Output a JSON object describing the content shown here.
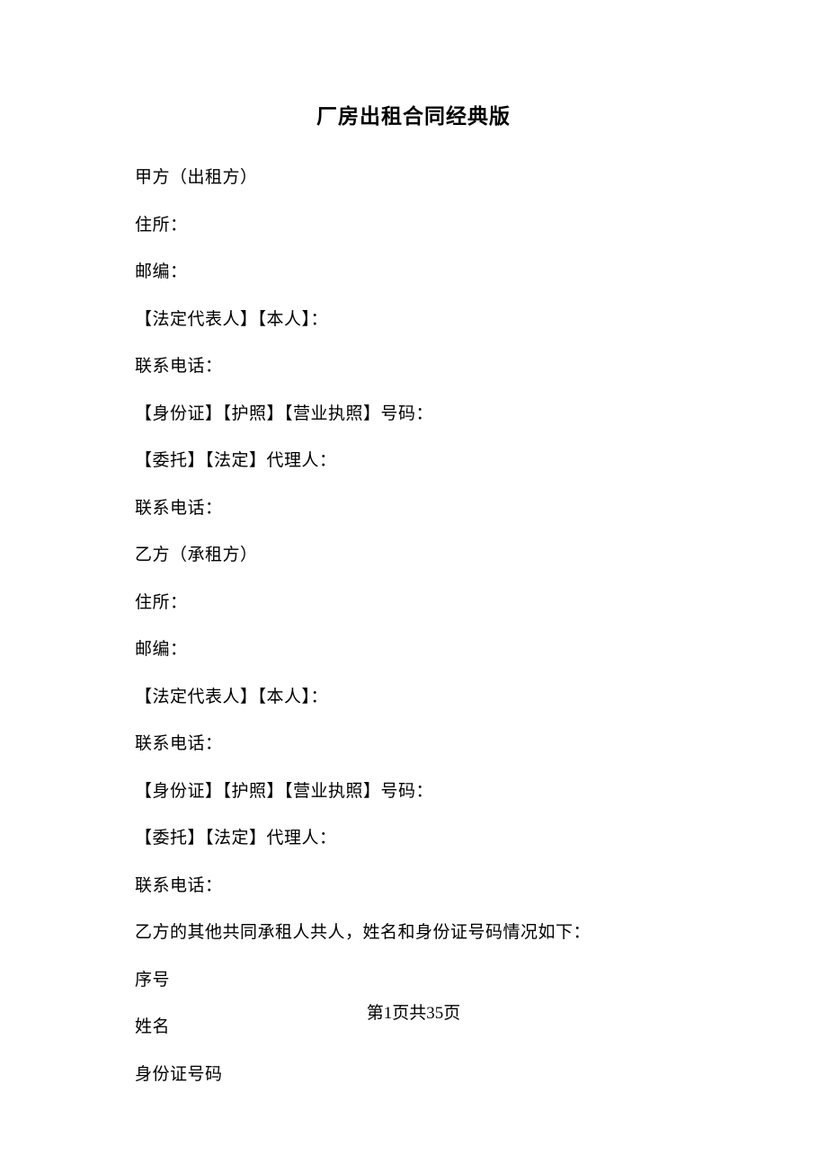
{
  "title": "厂房出租合同经典版",
  "lines": [
    "甲方（出租方）",
    "住所：",
    "邮编：",
    "【法定代表人】【本人】：",
    "联系电话：",
    "【身份证】【护照】【营业执照】号码：",
    "【委托】【法定】代理人：",
    "联系电话：",
    "乙方（承租方）",
    "住所：",
    "邮编：",
    "【法定代表人】【本人】：",
    "联系电话：",
    "【身份证】【护照】【营业执照】号码：",
    "【委托】【法定】代理人：",
    "联系电话：",
    "乙方的其他共同承租人共人，姓名和身份证号码情况如下：",
    "序号",
    "姓名",
    "身份证号码"
  ],
  "footer": "第1页共35页"
}
